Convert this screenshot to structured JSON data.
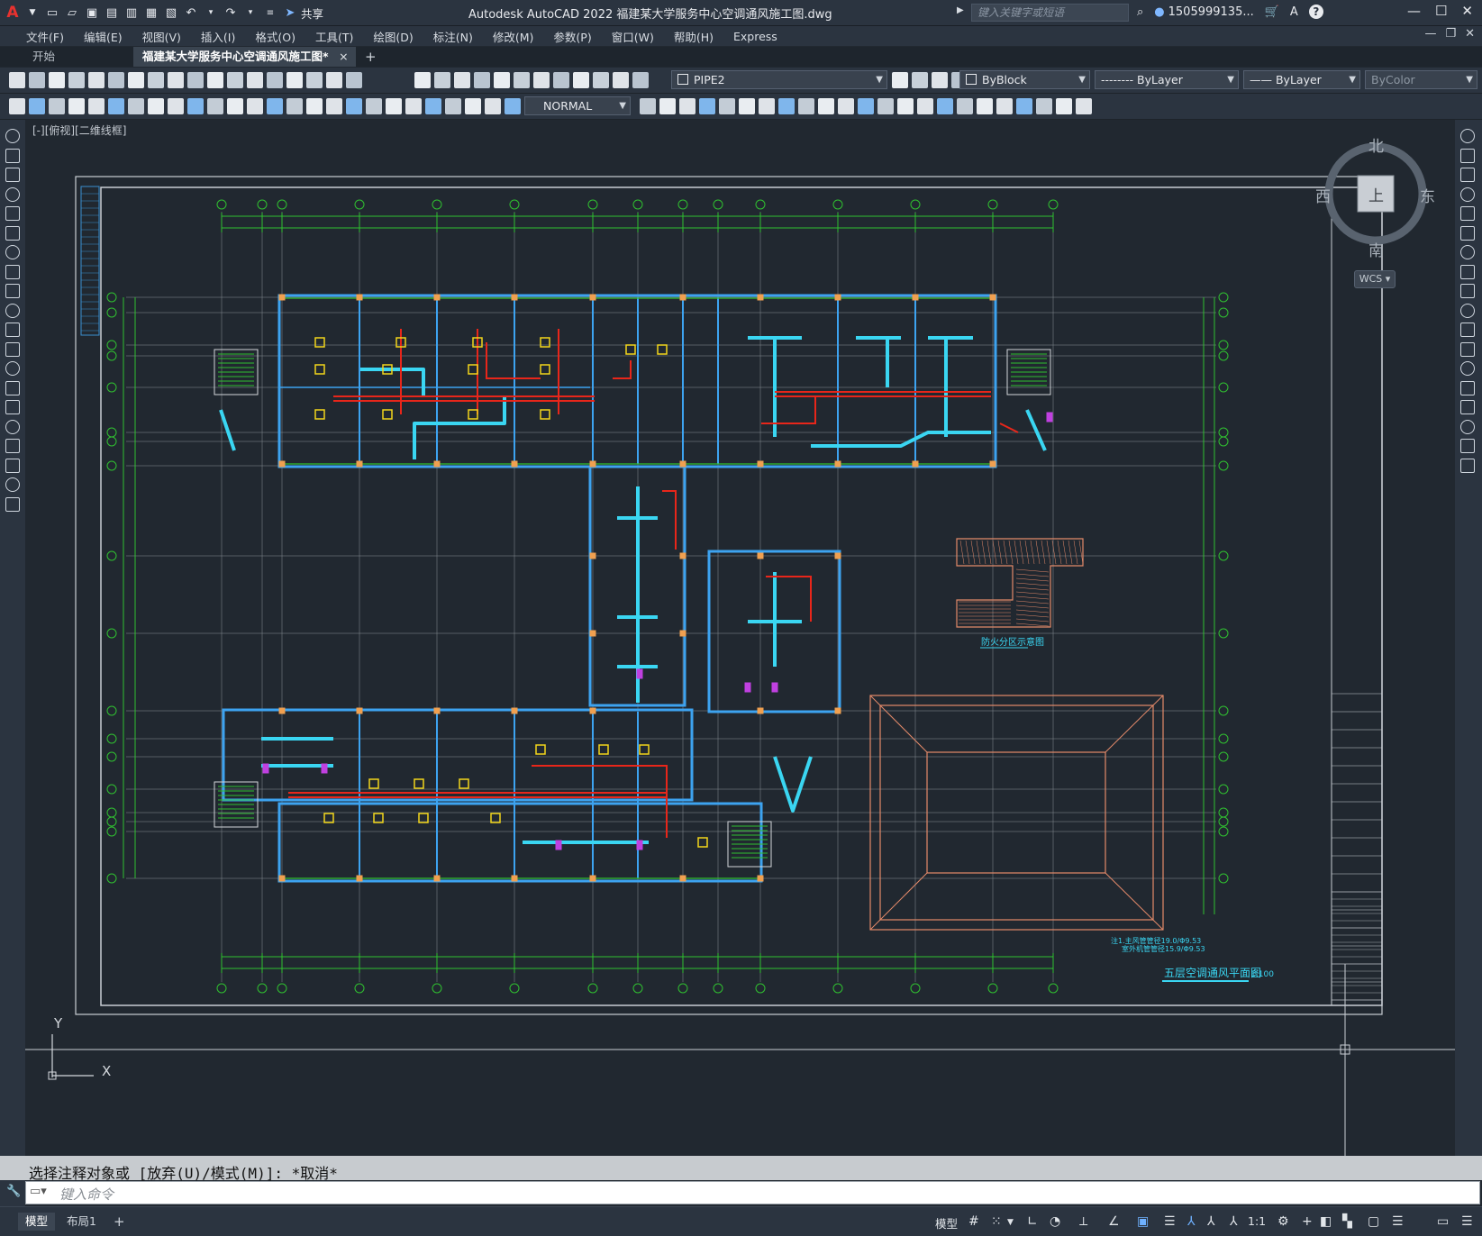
{
  "title_bar": {
    "app_badge": "A",
    "share_label": "共享",
    "title": "Autodesk AutoCAD 2022    福建某大学服务中心空调通风施工图.dwg",
    "search_placeholder": "键入关键字或短语",
    "user_name": "1505999135...",
    "help_icon": "?"
  },
  "menu": {
    "items": [
      "文件(F)",
      "编辑(E)",
      "视图(V)",
      "插入(I)",
      "格式(O)",
      "工具(T)",
      "绘图(D)",
      "标注(N)",
      "修改(M)",
      "参数(P)",
      "窗口(W)",
      "帮助(H)",
      "Express"
    ]
  },
  "tabs": {
    "start": "开始",
    "active_doc": "福建某大学服务中心空调通风施工图*",
    "close": "×",
    "add": "+"
  },
  "toolbar1": {
    "layer_value": "PIPE2",
    "color_value": "ByBlock",
    "linetype_value": "-------- ByLayer",
    "lineweight_value": "—— ByLayer",
    "plotstyle_value": "ByColor"
  },
  "toolbar2": {
    "dimstyle_value": "NORMAL"
  },
  "viewport": {
    "view_label": "[-][俯视][二维线框]"
  },
  "viewcube": {
    "north": "北",
    "south": "南",
    "east": "东",
    "west": "西",
    "face": "上",
    "wcs": "WCS"
  },
  "drawing": {
    "main_title": "五层空调通风平面图",
    "main_scale": "1:100",
    "key_plan_title": "防火分区示意图",
    "note_line1": "注1.主风管管径19.0/Φ9.53",
    "note_line2": "室外机管管径15.9/Φ9.53",
    "ucs_y": "Y",
    "ucs_x": "X",
    "colors": {
      "wall": "#3da3f0",
      "grid": "#30c030",
      "duct": "#3ad6f2",
      "pipe_red": "#e8261a",
      "unit_yellow": "#f2d61b",
      "coral": "#e48a6a"
    }
  },
  "command": {
    "history": "选择注释对象或 [放弃(U)/模式(M)]: *取消*",
    "input_placeholder": "键入命令"
  },
  "status_bar": {
    "model_tab": "模型",
    "layout_tab": "布局1",
    "add_tab": "+",
    "model_indicator": "模型",
    "scale": "1:1"
  }
}
